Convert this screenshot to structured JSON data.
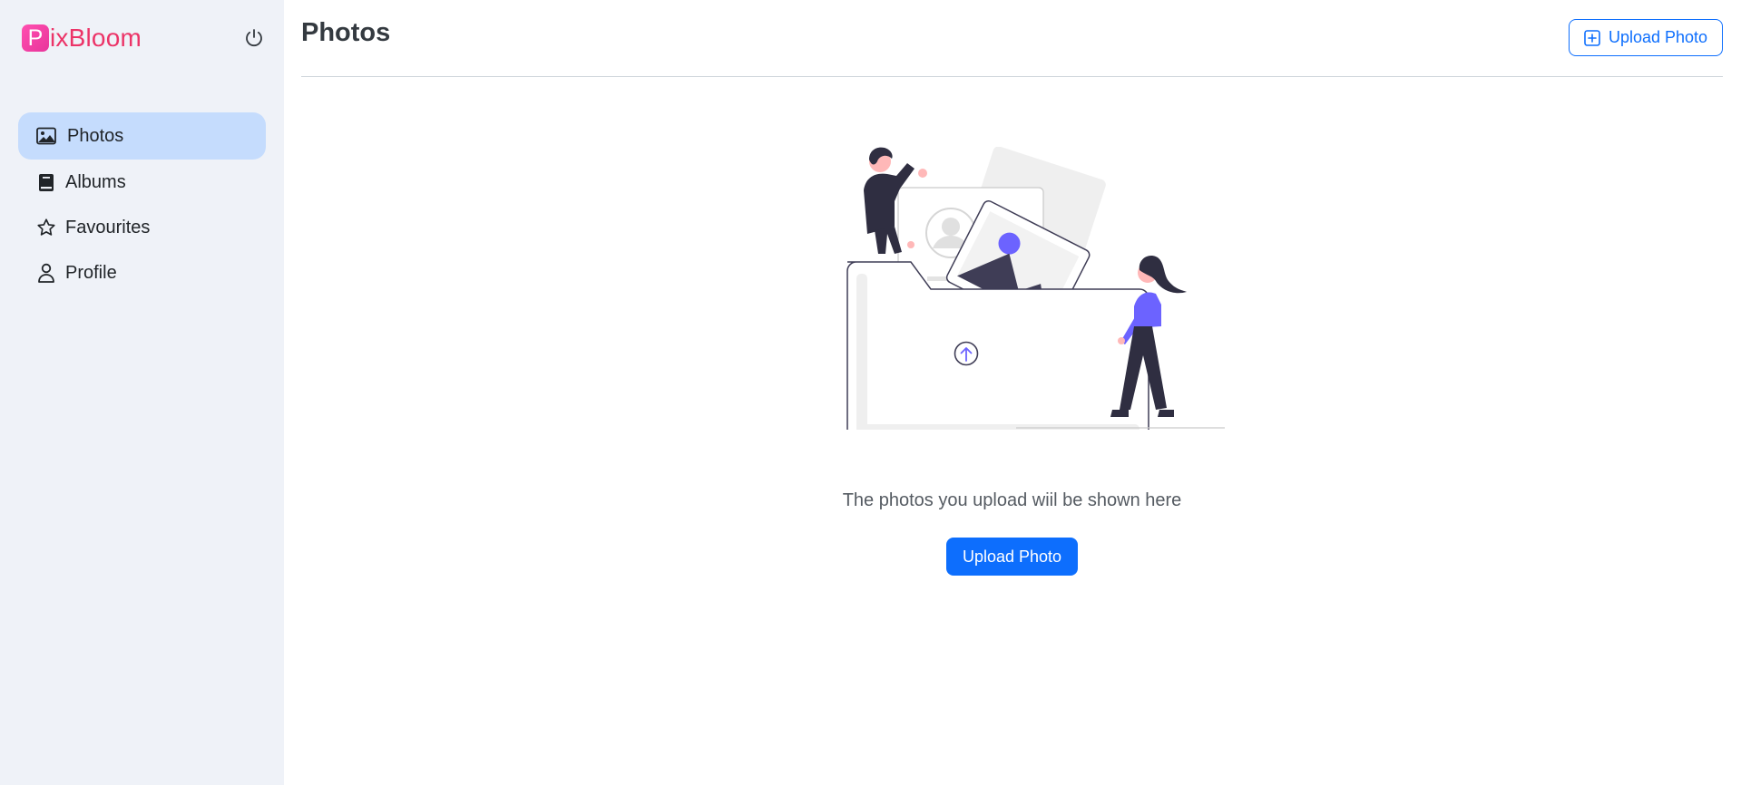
{
  "brand": {
    "initial": "P",
    "rest": "ixBloom"
  },
  "sidebar": {
    "items": [
      {
        "label": "Photos",
        "icon": "image-icon",
        "active": true
      },
      {
        "label": "Albums",
        "icon": "book-icon",
        "active": false
      },
      {
        "label": "Favourites",
        "icon": "star-icon",
        "active": false
      },
      {
        "label": "Profile",
        "icon": "person-icon",
        "active": false
      }
    ]
  },
  "header": {
    "title": "Photos",
    "upload_label": "Upload Photo"
  },
  "empty_state": {
    "message": "The photos you upload wiil be shown here",
    "button_label": "Upload Photo"
  },
  "colors": {
    "sidebar_bg": "#eff2f8",
    "active_bg": "#c5dcfd",
    "brand": "#ec3468",
    "primary": "#0d6efd",
    "illustration_accent": "#6c63ff"
  }
}
